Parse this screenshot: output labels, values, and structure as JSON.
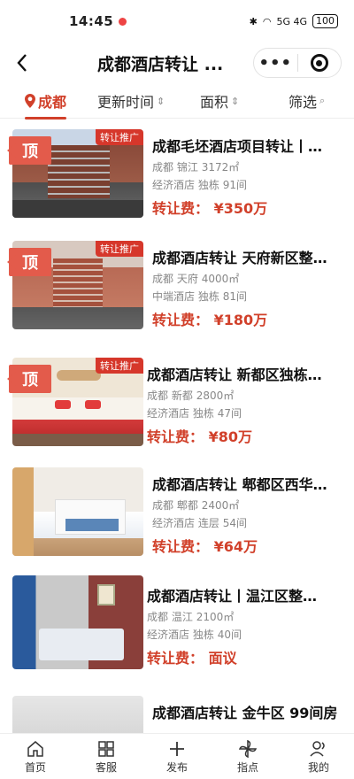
{
  "status": {
    "time": "14:45",
    "network": "5G 4G",
    "battery": "100"
  },
  "nav": {
    "back_icon": "back-arrow-icon",
    "title": "成都酒店转让 ...",
    "more": "•••"
  },
  "filters": {
    "city": "成都",
    "update_time": "更新时间",
    "area": "面积",
    "filter": "筛选"
  },
  "listings": [
    {
      "title": "成都毛坯酒店项目转让丨…",
      "city": "成都",
      "district": "锦江",
      "size": "3172㎡",
      "type": "经济酒店",
      "building": "独栋",
      "rooms": "91间",
      "fee_label": "转让费：",
      "fee": "¥350万",
      "promo": "转让推广",
      "top": "顶"
    },
    {
      "title": "成都酒店转让 天府新区整…",
      "city": "成都",
      "district": "天府",
      "size": "4000㎡",
      "type": "中端酒店",
      "building": "独栋",
      "rooms": "81间",
      "fee_label": "转让费：",
      "fee": "¥180万",
      "promo": "转让推广",
      "top": "顶"
    },
    {
      "title": "成都酒店转让 新都区独栋…",
      "city": "成都",
      "district": "新都",
      "size": "2800㎡",
      "type": "经济酒店",
      "building": "独栋",
      "rooms": "47间",
      "fee_label": "转让费：",
      "fee": "¥80万",
      "promo": "转让推广",
      "top": "顶"
    },
    {
      "title": "成都酒店转让 郫都区西华…",
      "city": "成都",
      "district": "郫都",
      "size": "2400㎡",
      "type": "经济酒店",
      "building": "连层",
      "rooms": "54间",
      "fee_label": "转让费：",
      "fee": "¥64万",
      "promo": "",
      "top": ""
    },
    {
      "title": "成都酒店转让丨温江区整…",
      "city": "成都",
      "district": "温江",
      "size": "2100㎡",
      "type": "经济酒店",
      "building": "独栋",
      "rooms": "40间",
      "fee_label": "转让费：",
      "fee": "面议",
      "promo": "",
      "top": ""
    },
    {
      "title": "成都酒店转让 金牛区 99间房",
      "city": "",
      "district": "",
      "size": "",
      "type": "",
      "building": "",
      "rooms": "",
      "fee_label": "",
      "fee": "",
      "promo": "",
      "top": ""
    }
  ],
  "tabbar": [
    {
      "label": "首页",
      "icon": "home-icon"
    },
    {
      "label": "客服",
      "icon": "grid-icon"
    },
    {
      "label": "发布",
      "icon": "plus-icon"
    },
    {
      "label": "指点",
      "icon": "pinwheel-icon"
    },
    {
      "label": "我的",
      "icon": "user-icon"
    }
  ],
  "colors": {
    "accent": "#d1402a",
    "promo": "#d6372b",
    "top_badge": "#e35b4b"
  }
}
